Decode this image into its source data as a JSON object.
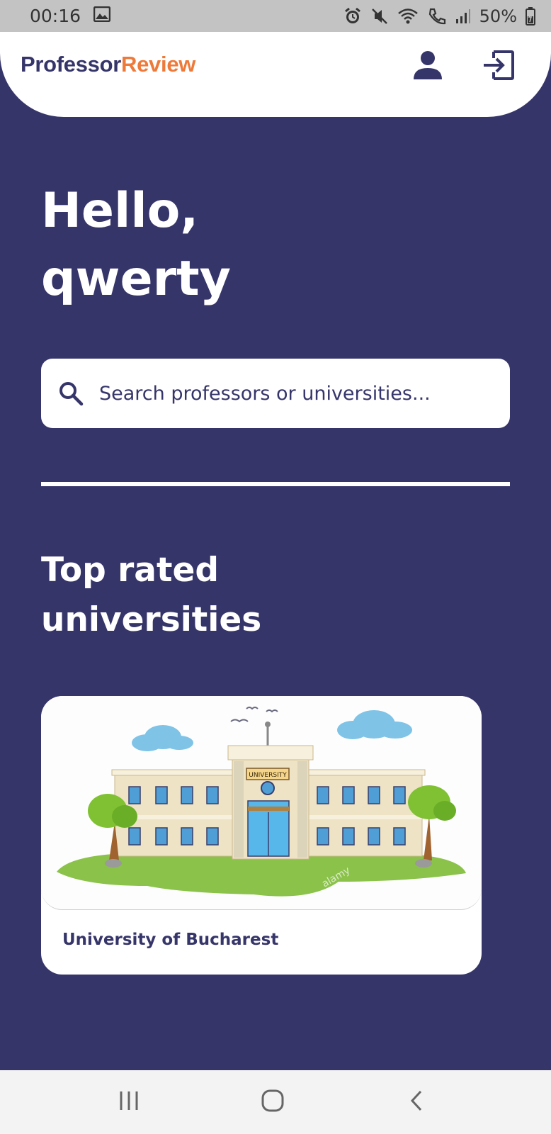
{
  "status_bar": {
    "time": "00:16",
    "battery": "50%",
    "icons": [
      "image-icon",
      "alarm-icon",
      "mute-icon",
      "wifi-icon",
      "call-icon",
      "signal-icon",
      "battery-icon"
    ]
  },
  "header": {
    "brand_part1": "Professor",
    "brand_part2": "Review",
    "icons": [
      "person-icon",
      "logout-icon"
    ]
  },
  "greeting": {
    "line1": "Hello,",
    "line2": "qwerty"
  },
  "search": {
    "placeholder": "Search professors or universities..."
  },
  "section": {
    "line1": "Top rated",
    "line2": "universities"
  },
  "universities": [
    {
      "name": "University of Bucharest",
      "sign": "UNIVERSITY",
      "watermark": "alamy"
    }
  ],
  "nav_bar": {
    "icons": [
      "recents-icon",
      "home-icon",
      "back-icon"
    ]
  },
  "colors": {
    "background": "#36356a",
    "accent": "#ee7a3a",
    "surface": "#ffffff"
  }
}
